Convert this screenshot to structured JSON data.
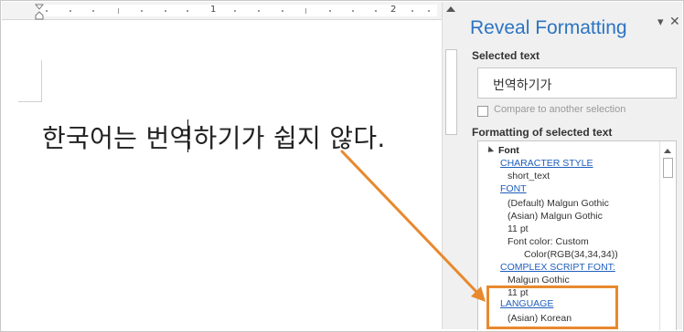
{
  "ruler": {
    "numbers": [
      "1",
      "2"
    ]
  },
  "document": {
    "text": "한국어는 번역하기가 쉽지 않다."
  },
  "panel": {
    "title": "Reveal Formatting",
    "dropdown_glyph": "▾",
    "close_glyph": "✕",
    "selected_text_heading": "Selected text",
    "selected_text_value": "번역하기가",
    "compare_label": "Compare to another selection",
    "formatting_heading": "Formatting of selected text",
    "formatting": {
      "font_group": "Font",
      "character_style_link": "CHARACTER STYLE",
      "character_style_value": "short_text",
      "font_link": "FONT",
      "font_default": "(Default) Malgun Gothic",
      "font_asian": "(Asian) Malgun Gothic",
      "font_size": "11 pt",
      "font_color": "Font color: Custom",
      "font_color_rgb": "Color(RGB(34,34,34))",
      "complex_script_link": "COMPLEX SCRIPT FONT:",
      "complex_script_font": "Malgun Gothic",
      "complex_script_size": "11 pt",
      "language_link": "LANGUAGE",
      "language_value": "(Asian) Korean"
    }
  },
  "colors": {
    "accent_blue": "#2b74c2",
    "link_blue": "#1e5ebc",
    "annotation_orange": "#e8892e"
  }
}
